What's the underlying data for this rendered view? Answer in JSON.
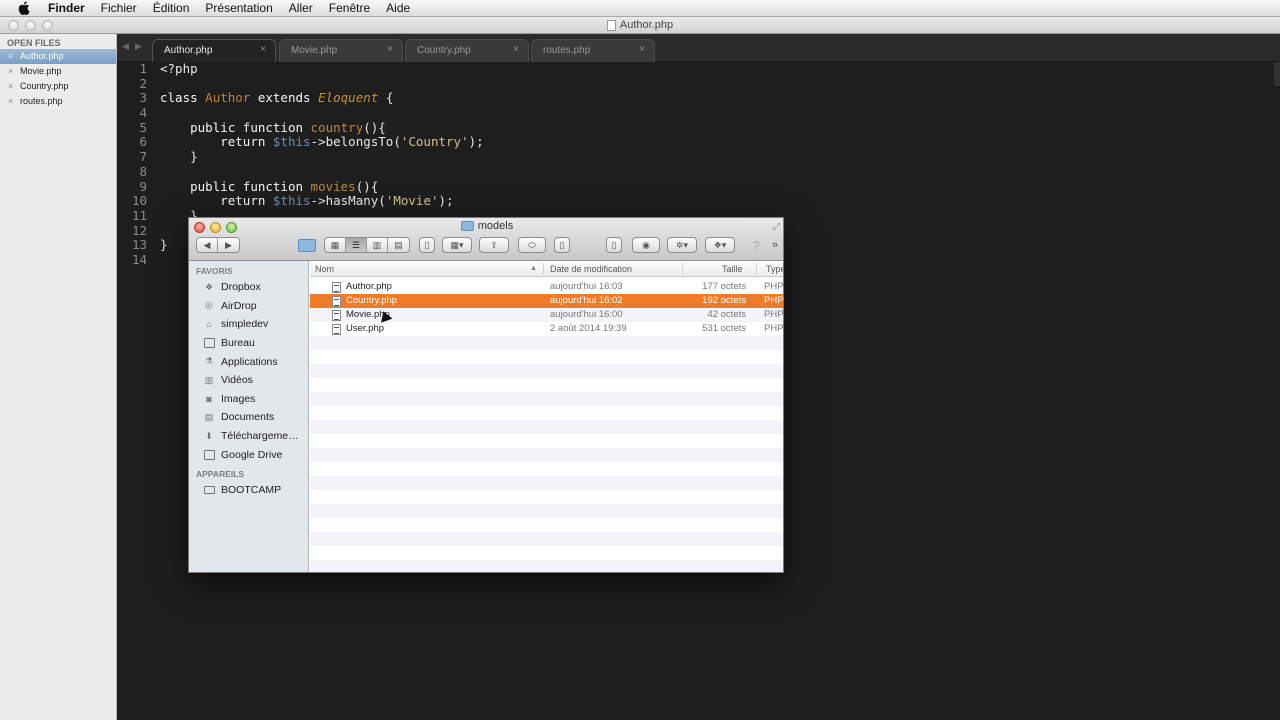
{
  "menubar": {
    "app_name": "Finder",
    "items": [
      "Fichier",
      "Édition",
      "Présentation",
      "Aller",
      "Fenêtre",
      "Aide"
    ]
  },
  "editor": {
    "window_title": "Author.php",
    "sidebar": {
      "header": "OPEN FILES",
      "files": [
        {
          "label": "Author.php",
          "active": true
        },
        {
          "label": "Movie.php",
          "active": false
        },
        {
          "label": "Country.php",
          "active": false
        },
        {
          "label": "routes.php",
          "active": false
        }
      ]
    },
    "tabs": [
      {
        "label": "Author.php",
        "active": true
      },
      {
        "label": "Movie.php",
        "active": false
      },
      {
        "label": "Country.php",
        "active": false
      },
      {
        "label": "routes.php",
        "active": false
      }
    ],
    "tab_close": "×",
    "line_numbers": [
      "1",
      "2",
      "3",
      "4",
      "5",
      "6",
      "7",
      "8",
      "9",
      "10",
      "11",
      "12",
      "13",
      "14"
    ],
    "code_lines": [
      "<?php",
      "",
      "class Author extends Eloquent {",
      "",
      "    public function country(){",
      "        return $this->belongsTo('Country');",
      "    }",
      "",
      "    public function movies(){",
      "        return $this->hasMany('Movie');",
      "    }",
      "",
      "}",
      ""
    ]
  },
  "finder": {
    "title": "models",
    "sidebar": {
      "favorites_header": "FAVORIS",
      "favorites": [
        {
          "label": "Dropbox",
          "icon": "dropbox-icon"
        },
        {
          "label": "AirDrop",
          "icon": "airdrop-icon"
        },
        {
          "label": "simpledev",
          "icon": "home-icon"
        },
        {
          "label": "Bureau",
          "icon": "desktop-icon"
        },
        {
          "label": "Applications",
          "icon": "applications-icon"
        },
        {
          "label": "Vidéos",
          "icon": "videos-icon"
        },
        {
          "label": "Images",
          "icon": "images-icon"
        },
        {
          "label": "Documents",
          "icon": "documents-icon"
        },
        {
          "label": "Téléchargeme…",
          "icon": "downloads-icon"
        },
        {
          "label": "Google Drive",
          "icon": "folder-icon"
        }
      ],
      "devices_header": "APPAREILS",
      "devices": [
        {
          "label": "BOOTCAMP",
          "icon": "disk-icon"
        }
      ]
    },
    "columns": {
      "name": "Nom",
      "date": "Date de modification",
      "size": "Taille",
      "type": "Type"
    },
    "files": [
      {
        "name": "Author.php",
        "date": "aujourd'hui 16:03",
        "size": "177 octets",
        "type": "PHP",
        "selected": false
      },
      {
        "name": "Country.php",
        "date": "aujourd'hui 16:02",
        "size": "192 octets",
        "type": "PHP",
        "selected": true
      },
      {
        "name": "Movie.php",
        "date": "aujourd'hui 16:00",
        "size": "42 octets",
        "type": "PHP",
        "selected": false
      },
      {
        "name": "User.php",
        "date": "2 août 2014 19:39",
        "size": "531 octets",
        "type": "PHP",
        "selected": false
      }
    ],
    "colors": {
      "selection": "#ef7b28",
      "sidebar_bg": "#e2e7ec"
    }
  }
}
